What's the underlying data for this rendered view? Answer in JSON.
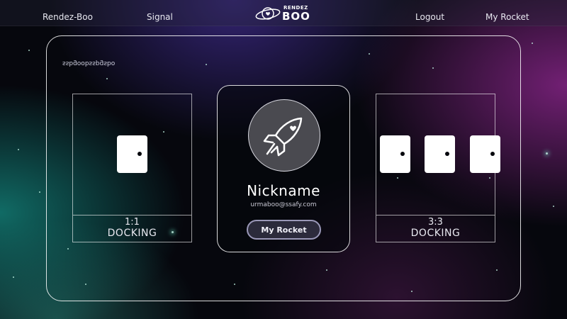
{
  "header": {
    "brand_link": "Rendez-Boo",
    "signal_link": "Signal",
    "logout_link": "Logout",
    "my_rocket_link": "My Rocket",
    "logo": {
      "top_text": "RENDEZ",
      "bottom_text": "BOO",
      "icon": "planet-heart-icon"
    }
  },
  "corner_text": "ssbgoobsspgsbo",
  "docking": {
    "one": {
      "count": "1:1",
      "word": "DOCKING",
      "doors": 1
    },
    "three": {
      "count": "3:3",
      "word": "DOCKING",
      "doors": 3
    }
  },
  "profile": {
    "avatar_icon": "rocket-heart-icon",
    "nickname": "Nickname",
    "email": "urmaboo@ssafy.com",
    "button_label": "My Rocket"
  },
  "colors": {
    "background": "#06070d",
    "button_border": "#9a98b8",
    "avatar_bg": "#4a4a50"
  }
}
